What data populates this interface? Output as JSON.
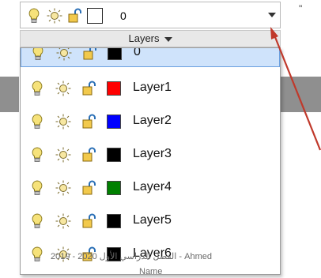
{
  "combo": {
    "value": "0",
    "swatch_color": "#ffffff"
  },
  "panel": {
    "title": "Layers"
  },
  "layers": [
    {
      "name": "0",
      "color": "#000000",
      "selected": true
    },
    {
      "name": "Layer1",
      "color": "#ff0000"
    },
    {
      "name": "Layer2",
      "color": "#0000ff"
    },
    {
      "name": "Layer3",
      "color": "#000000"
    },
    {
      "name": "Layer4",
      "color": "#008000"
    },
    {
      "name": "Layer5",
      "color": "#000000"
    },
    {
      "name": "Layer6",
      "color": "#000000"
    }
  ],
  "watermark": {
    "line1": "الفصل الدراسي الأول 2020 - 2019 - Ahmed",
    "line2": "Name"
  },
  "colors": {
    "pointer": "#c0392b",
    "selection": "#cfe3fb"
  }
}
